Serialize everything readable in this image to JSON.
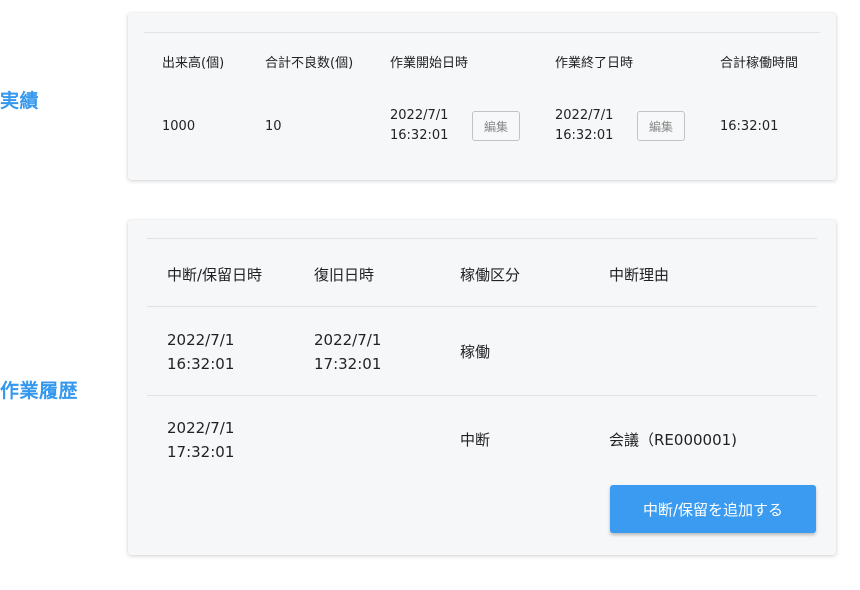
{
  "sections": {
    "results_label": "実績",
    "history_label": "作業履歴"
  },
  "results": {
    "headers": [
      "出来高(個)",
      "合計不良数(個)",
      "作業開始日時",
      "作業終了日時",
      "合計稼働時間"
    ],
    "quantity": "1000",
    "defects": "10",
    "start_date": "2022/7/1",
    "start_time": "16:32:01",
    "end_date": "2022/7/1",
    "end_time": "16:32:01",
    "total_time": "16:32:01",
    "edit_label": "編集"
  },
  "history": {
    "headers": [
      "中断/保留日時",
      "復旧日時",
      "稼働区分",
      "中断理由"
    ],
    "rows": [
      {
        "paused_date": "2022/7/1",
        "paused_time": "16:32:01",
        "resumed_date": "2022/7/1",
        "resumed_time": "17:32:01",
        "type": "稼働",
        "reason": ""
      },
      {
        "paused_date": "2022/7/1",
        "paused_time": "17:32:01",
        "resumed_date": "",
        "resumed_time": "",
        "type": "中断",
        "reason": "会議（RE000001)"
      }
    ],
    "add_button_label": "中断/保留を追加する"
  },
  "colors": {
    "accent": "#3a9bf0",
    "label": "#3598ef",
    "card_bg": "#f5f7f9"
  }
}
